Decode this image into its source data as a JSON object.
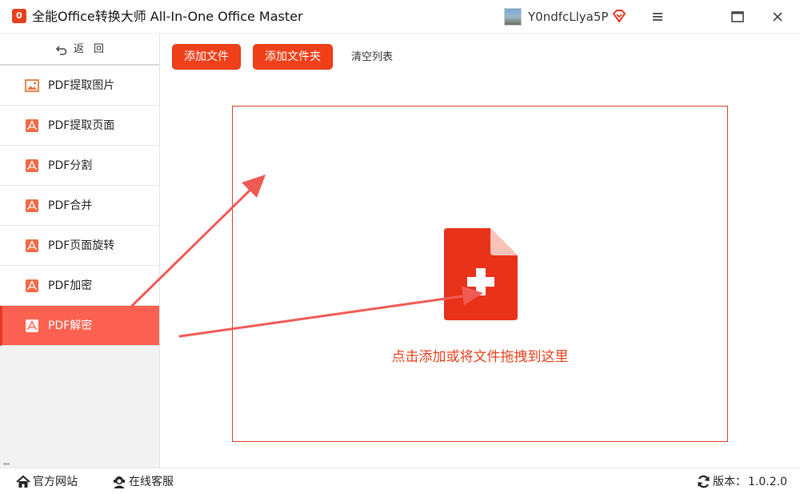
{
  "app": {
    "title": "全能Office转换大师 All-In-One Office Master",
    "logo_text": "0"
  },
  "user": {
    "name": "Y0ndfcLlya5P"
  },
  "colors": {
    "accent": "#f0401a",
    "active_nav": "#fd6151",
    "arrow": "#f05a55"
  },
  "sidebar": {
    "back_label": "返回",
    "items": [
      {
        "label": "PDF提取图片",
        "icon": "image-icon"
      },
      {
        "label": "PDF提取页面",
        "icon": "pdf-icon"
      },
      {
        "label": "PDF分割",
        "icon": "pdf-icon"
      },
      {
        "label": "PDF合并",
        "icon": "pdf-icon"
      },
      {
        "label": "PDF页面旋转",
        "icon": "pdf-icon"
      },
      {
        "label": "PDF加密",
        "icon": "pdf-icon"
      },
      {
        "label": "PDF解密",
        "icon": "pdf-icon",
        "active": true
      }
    ]
  },
  "toolbar": {
    "add_file_label": "添加文件",
    "add_folder_label": "添加文件夹",
    "clear_list_label": "清空列表"
  },
  "dropzone": {
    "hint": "点击添加或将文件拖拽到这里",
    "icon": "add-file-icon"
  },
  "footer": {
    "site_label": "官方网站",
    "service_label": "在线客服",
    "version_label": "版本：",
    "version_value": "1.0.2.0"
  }
}
